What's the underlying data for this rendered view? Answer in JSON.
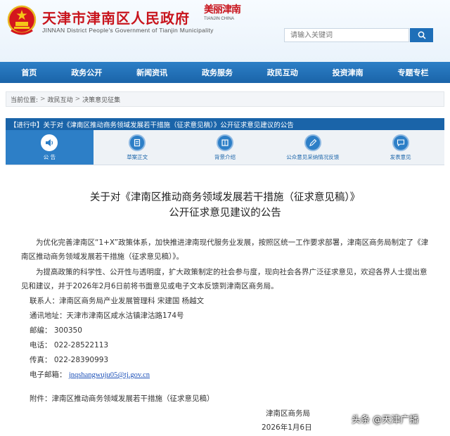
{
  "header": {
    "site_title": "天津市津南区人民政府",
    "site_subtitle": "JINNAN District People's Government of Tianjin Municipality",
    "seal_text": "美丽津南",
    "seal_subtext": "TIANJIN CHINA",
    "search_placeholder": "请输入关键词"
  },
  "nav": {
    "items": [
      "首页",
      "政务公开",
      "新闻资讯",
      "政务服务",
      "政民互动",
      "投资津南",
      "专题专栏"
    ]
  },
  "breadcrumb": {
    "label": "当前位置:",
    "items": [
      "政民互动",
      "决策意见征集"
    ]
  },
  "status_bar": {
    "text": "【进行中】关于对《津南区推动商务领域发展若干措施（征求意见稿）》公开征求意见建议的公告"
  },
  "tabs": [
    {
      "label": "公  告",
      "icon": "speaker-icon"
    },
    {
      "label": "草案正文",
      "icon": "document-icon"
    },
    {
      "label": "背景介绍",
      "icon": "book-icon"
    },
    {
      "label": "公众意见采纳情况反馈",
      "icon": "pencil-icon"
    },
    {
      "label": "发表意见",
      "icon": "chat-icon"
    }
  ],
  "article": {
    "title_line1": "关于对《津南区推动商务领域发展若干措施（征求意见稿）》",
    "title_line2": "公开征求意见建议的公告",
    "para1": "为优化完善津南区“1+X”政策体系，加快推进津南现代服务业发展，按照区统一工作要求部署，津南区商务局制定了《津南区推动商务领域发展若干措施（征求意见稿）》。",
    "para2": "为提高政策的科学性、公开性与透明度，扩大政策制定的社会参与度，现向社会各界广泛征求意见，欢迎各界人士提出意见和建议，并于2026年2月6日前将书面意见或电子文本反馈到津南区商务局。",
    "contact": "联系人：津南区商务局产业发展管理科  宋建国  杨越文",
    "address": "通讯地址：天津市津南区咸水沽镇津沽路174号",
    "postcode": "邮编：  300350",
    "phone": "电话：  022-28522113",
    "fax": "传真：  022-28390993",
    "email_label": "电子邮箱：",
    "email": "jnqshangwuju05@tj.gov.cn",
    "attachment": "附件：津南区推动商务领域发展若干措施（征求意见稿）",
    "sign_org": "津南区商务局",
    "sign_date": "2026年1月6日"
  },
  "watermark": "头条 @天津广播",
  "colors": {
    "brand_red": "#c8151d",
    "nav_blue": "#1a64a9",
    "link_blue": "#1a4fb8"
  }
}
